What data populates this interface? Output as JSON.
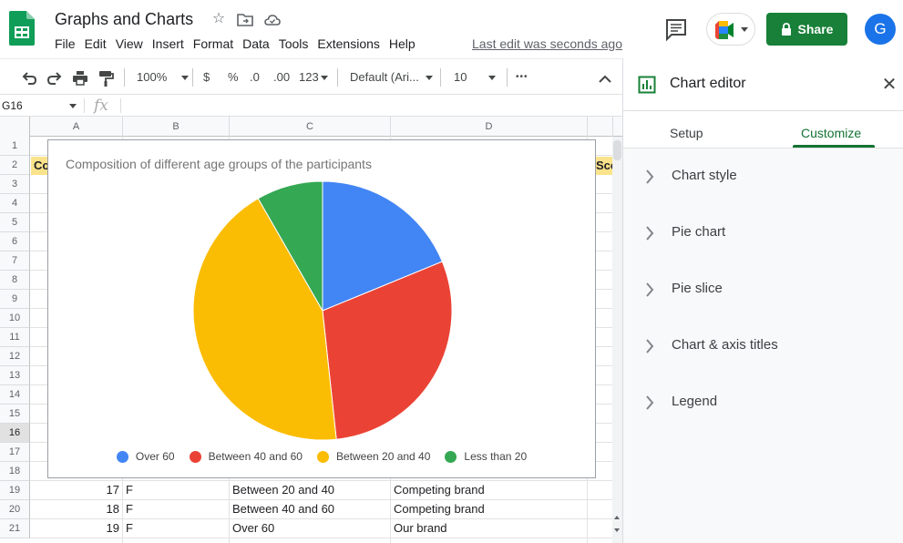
{
  "document": {
    "title": "Graphs and Charts",
    "last_edit": "Last edit was seconds ago"
  },
  "menu": [
    "File",
    "Edit",
    "View",
    "Insert",
    "Format",
    "Data",
    "Tools",
    "Extensions",
    "Help"
  ],
  "header": {
    "share_label": "Share",
    "avatar_initial": "G"
  },
  "toolbar": {
    "zoom": "100%",
    "currency": "$",
    "percent": "%",
    "decrease_decimal": ".0",
    "increase_decimal": ".00",
    "number_format": "123",
    "font": "Default (Ari...",
    "font_size": "10",
    "more": "•••"
  },
  "formula_bar": {
    "name_box": "G16",
    "fx": "fx"
  },
  "grid": {
    "columns": [
      "A",
      "B",
      "C",
      "D"
    ],
    "rows": [
      "1",
      "2",
      "3",
      "4",
      "5",
      "6",
      "7",
      "8",
      "9",
      "10",
      "11",
      "12",
      "13",
      "14",
      "15",
      "16",
      "17",
      "18",
      "19",
      "20",
      "21"
    ],
    "selected_row": "16",
    "header_fragments": {
      "a2": "Co",
      "e2": "Sco"
    },
    "data_rows": [
      {
        "row": "19",
        "a": "17",
        "b": "F",
        "c": "Between 20 and 40",
        "d": "Competing brand"
      },
      {
        "row": "20",
        "a": "18",
        "b": "F",
        "c": "Between 40 and 60",
        "d": "Competing brand"
      },
      {
        "row": "21",
        "a": "19",
        "b": "F",
        "c": "Over 60",
        "d": "Our brand"
      }
    ]
  },
  "chart_data": {
    "type": "pie",
    "title": "Composition of different age groups of the participants",
    "categories": [
      "Over 60",
      "Between 40 and 60",
      "Between 20 and 40",
      "Less than 20"
    ],
    "values": [
      18.8,
      29.5,
      43.4,
      8.3
    ],
    "colors": [
      "#4285f4",
      "#ea4335",
      "#fbbc04",
      "#34a853"
    ],
    "legend_position": "bottom"
  },
  "chart_editor": {
    "title": "Chart editor",
    "tabs": [
      "Setup",
      "Customize"
    ],
    "active_tab": "Customize",
    "sections": [
      "Chart style",
      "Pie chart",
      "Pie slice",
      "Chart & axis titles",
      "Legend"
    ]
  }
}
